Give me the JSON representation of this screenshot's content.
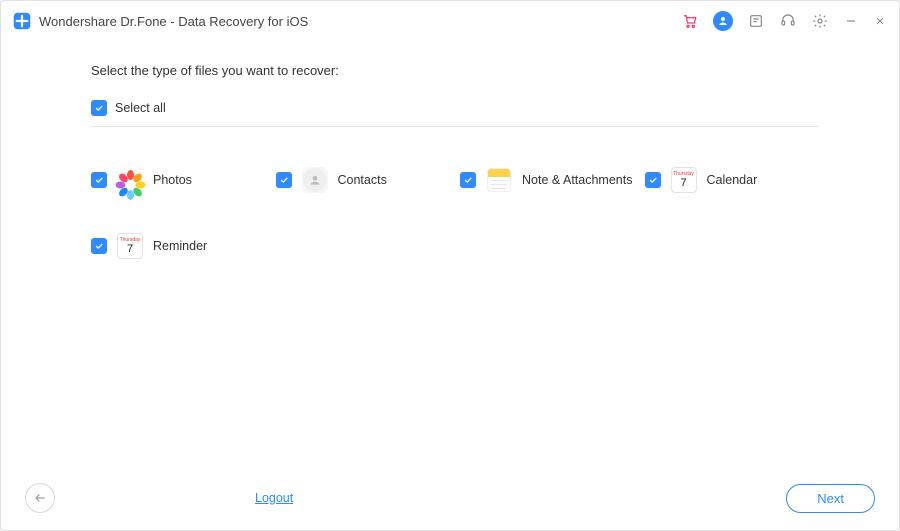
{
  "titlebar": {
    "title": "Wondershare Dr.Fone - Data Recovery for iOS"
  },
  "content": {
    "prompt": "Select the type of files you want to recover:",
    "select_all_label": "Select all"
  },
  "types": [
    {
      "key": "photos",
      "label": "Photos",
      "checked": true
    },
    {
      "key": "contacts",
      "label": "Contacts",
      "checked": true
    },
    {
      "key": "notes",
      "label": "Note & Attachments",
      "checked": true
    },
    {
      "key": "calendar",
      "label": "Calendar",
      "checked": true,
      "day_text": "Thursday",
      "day_num": "7"
    },
    {
      "key": "reminder",
      "label": "Reminder",
      "checked": true,
      "day_text": "Thursday",
      "day_num": "7"
    }
  ],
  "footer": {
    "logout_label": "Logout",
    "next_label": "Next"
  },
  "colors": {
    "accent": "#2f8aff",
    "cart": "#ff3d6b"
  }
}
